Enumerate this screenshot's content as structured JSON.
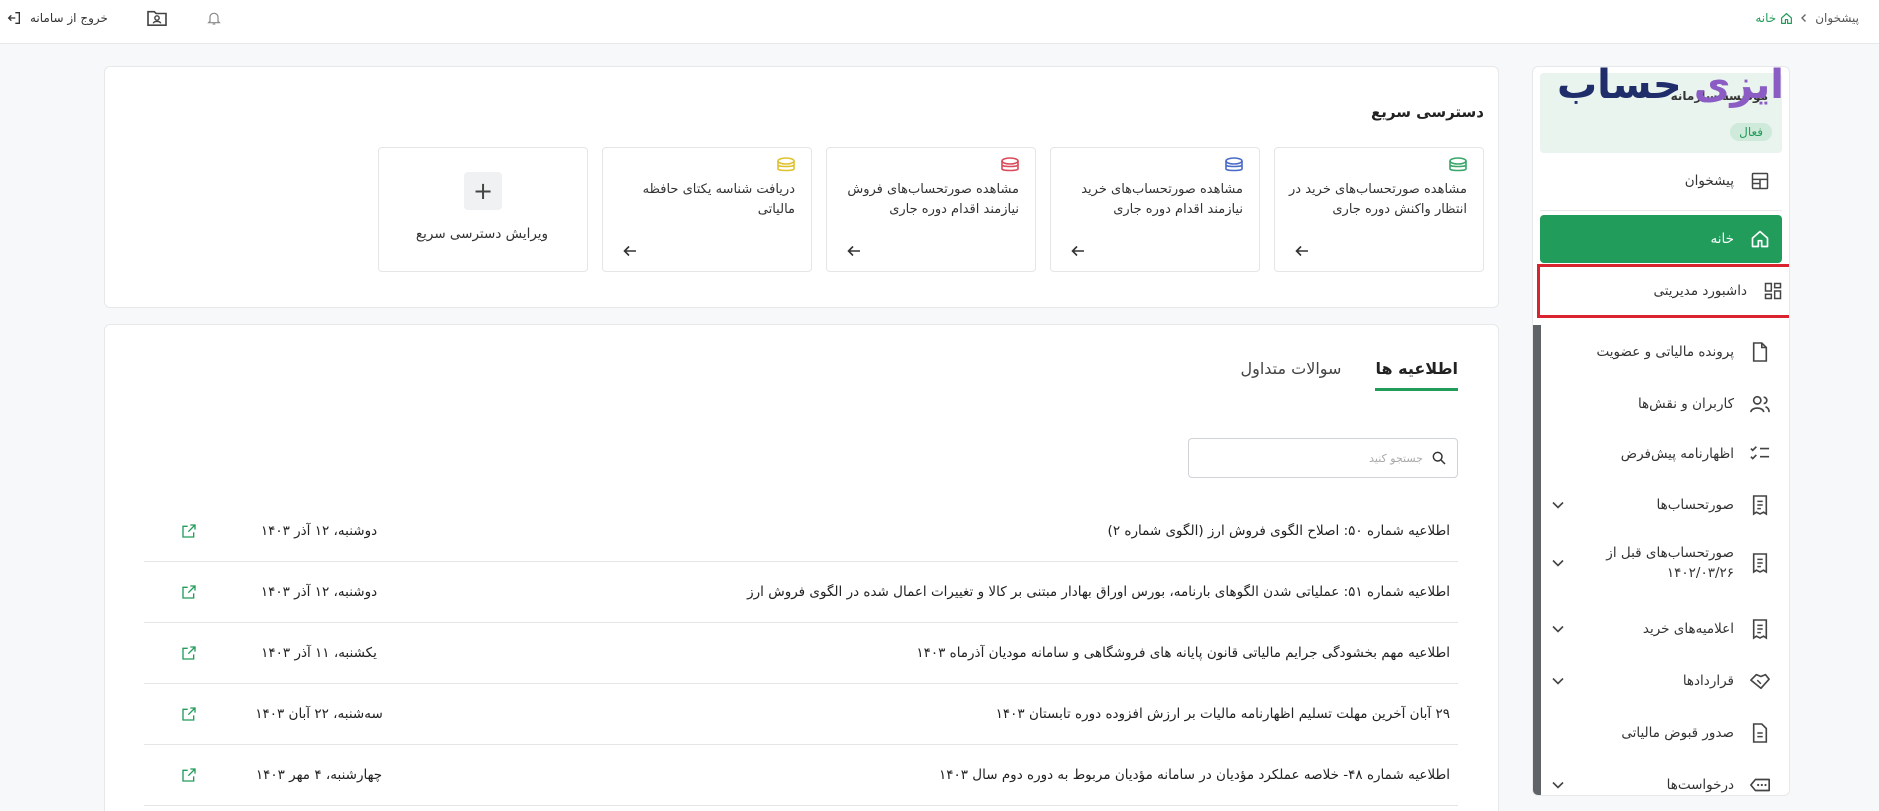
{
  "topbar": {
    "breadcrumb": {
      "root": "پیشخوان",
      "current": "خانه"
    },
    "logout_label": "خروج از سامانه"
  },
  "logo": {
    "part1": "ایزی",
    "part2": "حساب"
  },
  "sidebar": {
    "org_name": "موسسه سازمانه",
    "org_status": "فعال",
    "items": [
      {
        "label": "پیشخوان",
        "icon": "dashboard-panel-icon"
      },
      {
        "label": "خانه",
        "icon": "home-icon",
        "active": true
      },
      {
        "label": "داشبورد مدیریتی",
        "icon": "grid-icon",
        "highlight": true
      },
      {
        "label": "پرونده مالیاتی و عضویت",
        "icon": "file-icon"
      },
      {
        "label": "کاربران و نقش‌ها",
        "icon": "users-icon"
      },
      {
        "label": "اظهارنامه پیش‌فرض",
        "icon": "checklist-icon"
      },
      {
        "label": "صورتحساب‌ها",
        "icon": "invoice-icon",
        "expandable": true
      },
      {
        "label": "صورتحساب‌های قبل از",
        "label2": "۱۴۰۲/۰۳/۲۶",
        "icon": "invoice-icon",
        "expandable": true
      },
      {
        "label": "اعلامیه‌های خرید",
        "icon": "invoice-icon",
        "expandable": true
      },
      {
        "label": "قراردادها",
        "icon": "handshake-icon",
        "expandable": true
      },
      {
        "label": "صدور قبوض مالیاتی",
        "icon": "document-icon"
      },
      {
        "label": "درخواست‌ها",
        "icon": "ellipsis-icon",
        "expandable": true
      }
    ]
  },
  "quick_access": {
    "title": "دسترسی سریع",
    "tiles": [
      {
        "text": "مشاهده صورتحساب‌های خرید در انتظار واکنش دوره جاری",
        "icon_color": "#3aa66b"
      },
      {
        "text": "مشاهده صورتحساب‌های خرید نیازمند اقدام دوره جاری",
        "icon_color": "#4a6cc7"
      },
      {
        "text": "مشاهده صورتحساب‌های فروش نیازمند اقدام دوره جاری",
        "icon_color": "#d94a5a"
      },
      {
        "text": "دریافت شناسه یکتای حافظه مالیاتی",
        "icon_color": "#e0c230"
      }
    ],
    "add_label": "ویرایش دسترسی سریع"
  },
  "news": {
    "tabs": [
      {
        "label": "اطلاعیه ها",
        "active": true
      },
      {
        "label": "سوالات متداول",
        "active": false
      }
    ],
    "search_placeholder": "جستجو کنید",
    "items": [
      {
        "title": "اطلاعیه شماره ۵۰: اصلاح الگوی فروش ارز (الگوی شماره ۲)",
        "date": "دوشنبه، ۱۲ آذر ۱۴۰۳"
      },
      {
        "title": "اطلاعیه شماره ۵۱: عملیاتی شدن الگوهای بارنامه، بورس اوراق بهادار مبتنی بر کالا و تغییرات اعمال شده در الگوی فروش ارز",
        "date": "دوشنبه، ۱۲ آذر ۱۴۰۳"
      },
      {
        "title": "اطلاعیه مهم بخشودگی جرایم مالیاتی قانون پایانه های فروشگاهی و سامانه مودیان آذرماه ۱۴۰۳",
        "date": "یکشنبه، ۱۱ آذر ۱۴۰۳"
      },
      {
        "title": "۲۹ آبان آخرین مهلت تسلیم اظهارنامه مالیات بر ارزش افزوده دوره تابستان ۱۴۰۳",
        "date": "سه‌شنبه، ۲۲ آبان ۱۴۰۳"
      },
      {
        "title": "اطلاعیه شماره ۴۸- خلاصه عملکرد مؤدیان در سامانه مؤدیان مربوط به دوره دوم سال ۱۴۰۳",
        "date": "چهارشنبه، ۴ مهر ۱۴۰۳"
      }
    ]
  },
  "colors": {
    "accent": "#219c5a",
    "highlight": "#d9232e"
  }
}
